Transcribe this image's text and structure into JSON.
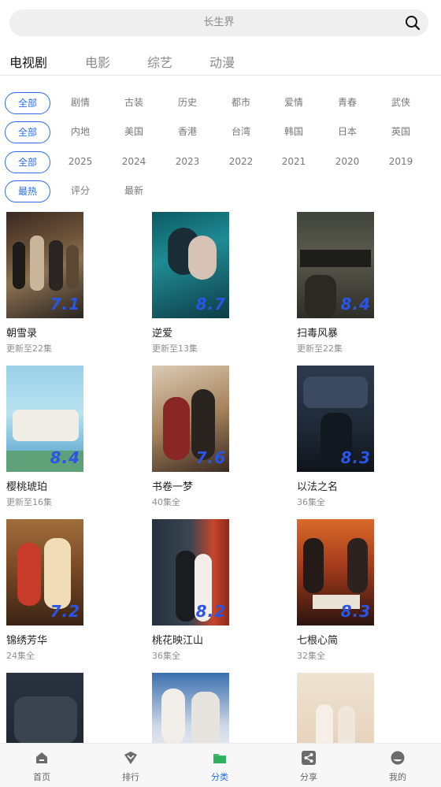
{
  "search": {
    "placeholder": "长生界"
  },
  "tabs": [
    {
      "label": "电视剧",
      "active": true
    },
    {
      "label": "电影",
      "active": false
    },
    {
      "label": "综艺",
      "active": false
    },
    {
      "label": "动漫",
      "active": false
    }
  ],
  "filters": {
    "genre": [
      "全部",
      "剧情",
      "古装",
      "历史",
      "都市",
      "爱情",
      "青春",
      "武侠"
    ],
    "region": [
      "全部",
      "内地",
      "美国",
      "香港",
      "台湾",
      "韩国",
      "日本",
      "英国"
    ],
    "year": [
      "全部",
      "2025",
      "2024",
      "2023",
      "2022",
      "2021",
      "2020",
      "2019"
    ],
    "sort": [
      "最热",
      "评分",
      "最新"
    ]
  },
  "shows": [
    {
      "title": "朝雪录",
      "status": "更新至22集",
      "rating": "7.1"
    },
    {
      "title": "逆爱",
      "status": "更新至13集",
      "rating": "8.7"
    },
    {
      "title": "扫毒风暴",
      "status": "更新至22集",
      "rating": "8.4"
    },
    {
      "title": "樱桃琥珀",
      "status": "更新至16集",
      "rating": "8.4"
    },
    {
      "title": "书卷一梦",
      "status": "40集全",
      "rating": "7.6"
    },
    {
      "title": "以法之名",
      "status": "36集全",
      "rating": "8.3"
    },
    {
      "title": "锦绣芳华",
      "status": "24集全",
      "rating": "7.2"
    },
    {
      "title": "桃花映江山",
      "status": "36集全",
      "rating": "8.2"
    },
    {
      "title": "七根心简",
      "status": "32集全",
      "rating": "8.3"
    },
    {
      "title": "",
      "status": "",
      "rating": ""
    },
    {
      "title": "",
      "status": "",
      "rating": ""
    },
    {
      "title": "",
      "status": "",
      "rating": ""
    }
  ],
  "nav": [
    {
      "label": "首页",
      "icon": "home-icon"
    },
    {
      "label": "排行",
      "icon": "ranking-icon"
    },
    {
      "label": "分类",
      "icon": "folder-icon",
      "active": true
    },
    {
      "label": "分享",
      "icon": "share-icon"
    },
    {
      "label": "我的",
      "icon": "profile-icon"
    }
  ],
  "colors": {
    "accent": "#2b6de8",
    "rating": "#2a55e8"
  }
}
